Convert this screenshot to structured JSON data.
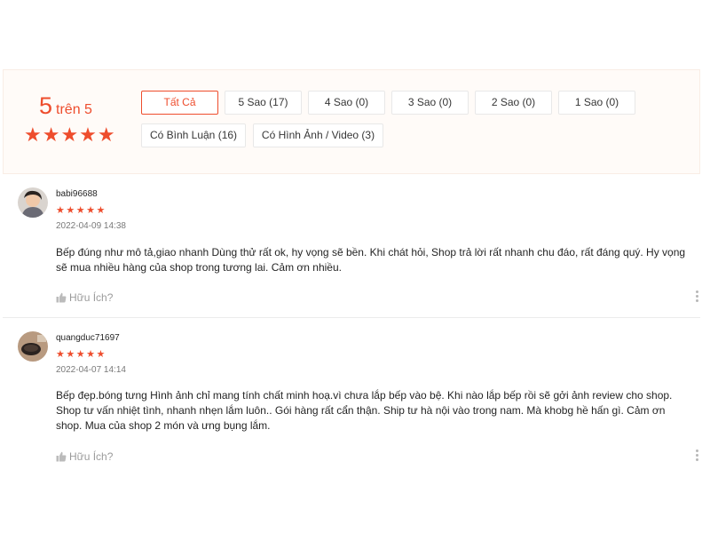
{
  "summary": {
    "rating_value": "5",
    "rating_suffix": "trên 5",
    "stars": "★★★★★"
  },
  "filters": [
    {
      "label": "Tất Cả"
    },
    {
      "label": "5 Sao (17)"
    },
    {
      "label": "4 Sao (0)"
    },
    {
      "label": "3 Sao (0)"
    },
    {
      "label": "2 Sao (0)"
    },
    {
      "label": "1 Sao (0)"
    },
    {
      "label": "Có Bình Luận (16)"
    },
    {
      "label": "Có Hình Ảnh / Video (3)"
    }
  ],
  "reviews": [
    {
      "author": "babi96688",
      "stars": "★★★★★",
      "time": "2022-04-09 14:38",
      "text": "Bếp đúng như mô tả,giao nhanh Dùng thử rất ok, hy vọng sẽ bền. Khi chát hỏi, Shop trả lời rất nhanh chu đáo, rất đáng quý. Hy vọng sẽ mua nhiều hàng của shop trong tương lai. Cảm ơn nhiều.",
      "useful": "Hữu Ích?"
    },
    {
      "author": "quangduc71697",
      "stars": "★★★★★",
      "time": "2022-04-07 14:14",
      "text": "Bếp đẹp.bóng tưng Hình ảnh chỉ mang tính chất minh hoạ.vì chưa lắp bếp vào bệ. Khi nào lắp bếp rồi sẽ gởi ảnh review cho shop. Shop tư vấn nhiệt tình, nhanh nhẹn lắm luôn.. Gói hàng rất cẩn thận. Ship tư hà nội vào trong nam. Mà khobg hề hấn gì. Cảm ơn shop. Mua của shop 2 món và ưng bụng lắm.",
      "useful": "Hữu Ích?"
    }
  ],
  "colors": {
    "accent": "#ee4d2d",
    "summary_bg": "#fffbf8"
  }
}
